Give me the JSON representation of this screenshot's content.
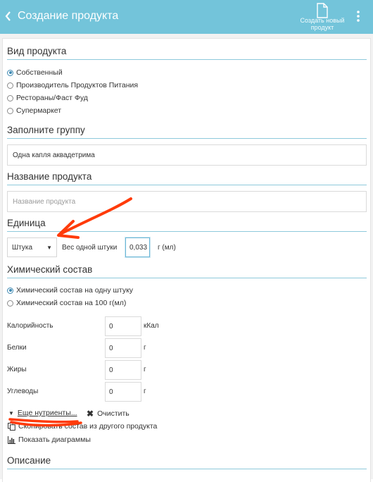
{
  "header": {
    "title": "Создание продукта",
    "create_new_label": "Создать новый продукт"
  },
  "product_type": {
    "heading": "Вид продукта",
    "options": [
      {
        "label": "Собственный",
        "selected": true
      },
      {
        "label": "Производитель Продуктов Питания",
        "selected": false
      },
      {
        "label": "Рестораны/Фаст Фуд",
        "selected": false
      },
      {
        "label": "Супермаркет",
        "selected": false
      }
    ]
  },
  "group": {
    "heading": "Заполните группу",
    "value": "Одна капля аквадетрима"
  },
  "product_name": {
    "heading": "Название продукта",
    "placeholder": "Название продукта",
    "value": ""
  },
  "unit": {
    "heading": "Единица",
    "selected": "Штука",
    "weight_label": "Вес одной штуки",
    "weight_value": "0,033",
    "weight_unit": "г (мл)"
  },
  "chem": {
    "heading": "Химический состав",
    "options": [
      {
        "label": "Химический состав на одну штуку",
        "selected": true
      },
      {
        "label": "Химический состав на 100 г(мл)",
        "selected": false
      }
    ],
    "nutrients": [
      {
        "label": "Калорийность",
        "value": "0",
        "unit": "кКал"
      },
      {
        "label": "Белки",
        "value": "0",
        "unit": "г"
      },
      {
        "label": "Жиры",
        "value": "0",
        "unit": "г"
      },
      {
        "label": "Углеводы",
        "value": "0",
        "unit": "г"
      }
    ],
    "more_link": "Еще нутриенты...",
    "clear_label": "Очистить",
    "copy_link": "Скопировать состав из другого продукта",
    "charts_link": "Показать диаграммы"
  },
  "description": {
    "heading": "Описание"
  },
  "colors": {
    "header_bg": "#73c4da",
    "section_line": "#8ec9db",
    "annotation": "#ff3b0a",
    "radio_active": "#3f8ab3"
  }
}
